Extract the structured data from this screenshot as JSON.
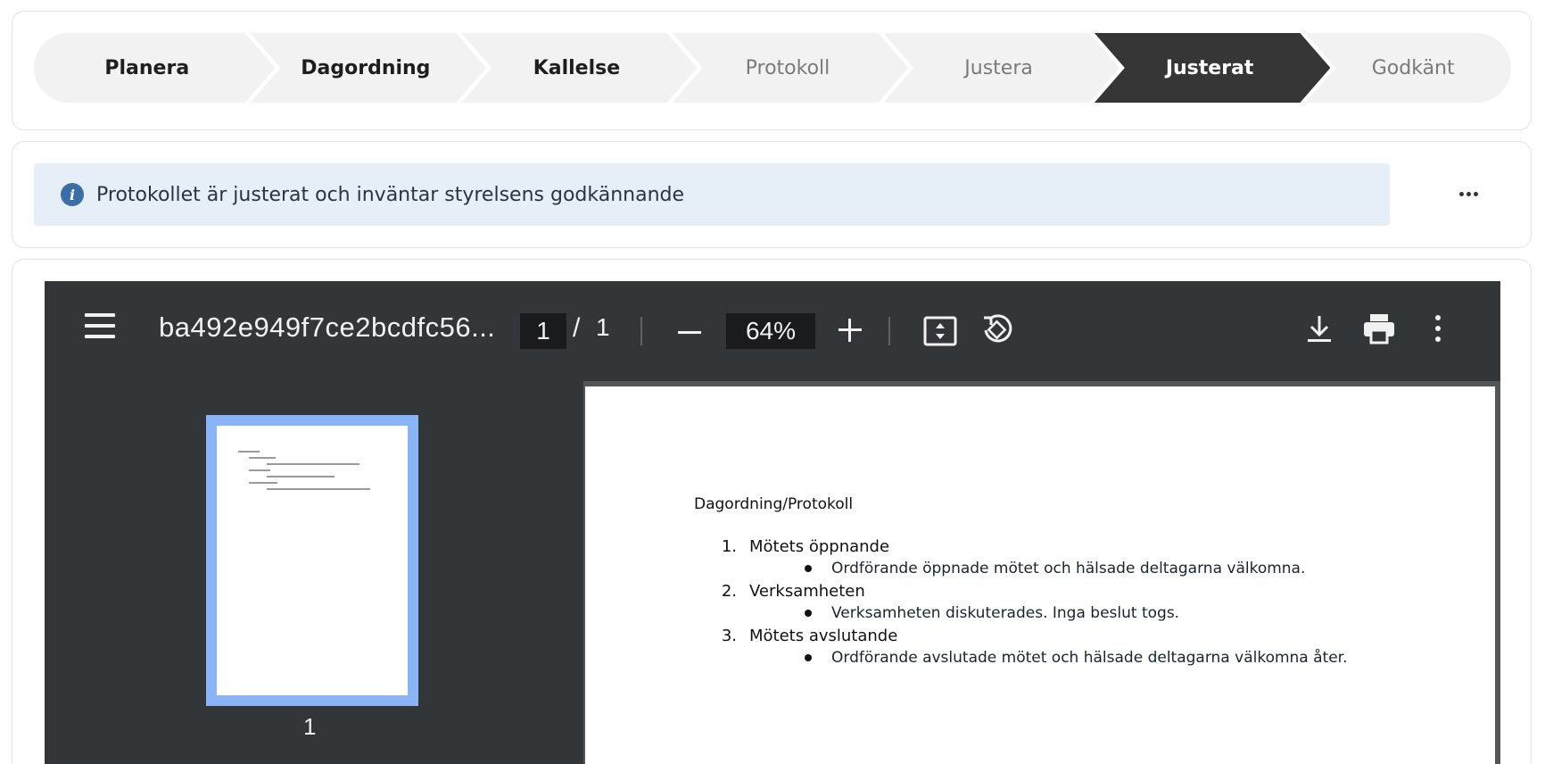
{
  "stepper": {
    "steps": [
      {
        "label": "Planera",
        "state": "done"
      },
      {
        "label": "Dagordning",
        "state": "done"
      },
      {
        "label": "Kallelse",
        "state": "done"
      },
      {
        "label": "Protokoll",
        "state": "pending"
      },
      {
        "label": "Justera",
        "state": "pending"
      },
      {
        "label": "Justerat",
        "state": "active"
      },
      {
        "label": "Godkänt",
        "state": "pending"
      }
    ]
  },
  "info": {
    "icon": "info-icon",
    "message": "Protokollet är justerat och inväntar styrelsens godkännande",
    "more_icon": "more-horizontal-icon"
  },
  "pdf_viewer": {
    "filename": "ba492e949f7ce2bcdfc56...",
    "current_page": "1",
    "page_separator": "/",
    "total_pages": "1",
    "zoom": "64%",
    "thumbnail_label": "1",
    "icons": [
      "menu-icon",
      "zoom-out-icon",
      "zoom-in-icon",
      "fit-page-icon",
      "rotate-icon",
      "download-icon",
      "print-icon",
      "more-vertical-icon"
    ]
  },
  "document": {
    "title": "Dagordning/Protokoll",
    "items": [
      {
        "num": "1.",
        "label": "Mötets öppnande",
        "bullet": "Ordförande öppnade mötet och hälsade deltagarna välkomna."
      },
      {
        "num": "2.",
        "label": "Verksamheten",
        "bullet": "Verksamheten diskuterades. Inga beslut togs."
      },
      {
        "num": "3.",
        "label": "Mötets avslutande",
        "bullet": "Ordförande avslutade mötet och hälsade deltagarna välkomna åter."
      }
    ]
  },
  "colors": {
    "active_step": "#363636",
    "inactive_step": "#f2f2f2",
    "info_background": "#e6eef7",
    "info_icon": "#3a6ea5",
    "viewer_toolbar": "#323639",
    "thumbnail_highlight": "#8ab4f8"
  }
}
